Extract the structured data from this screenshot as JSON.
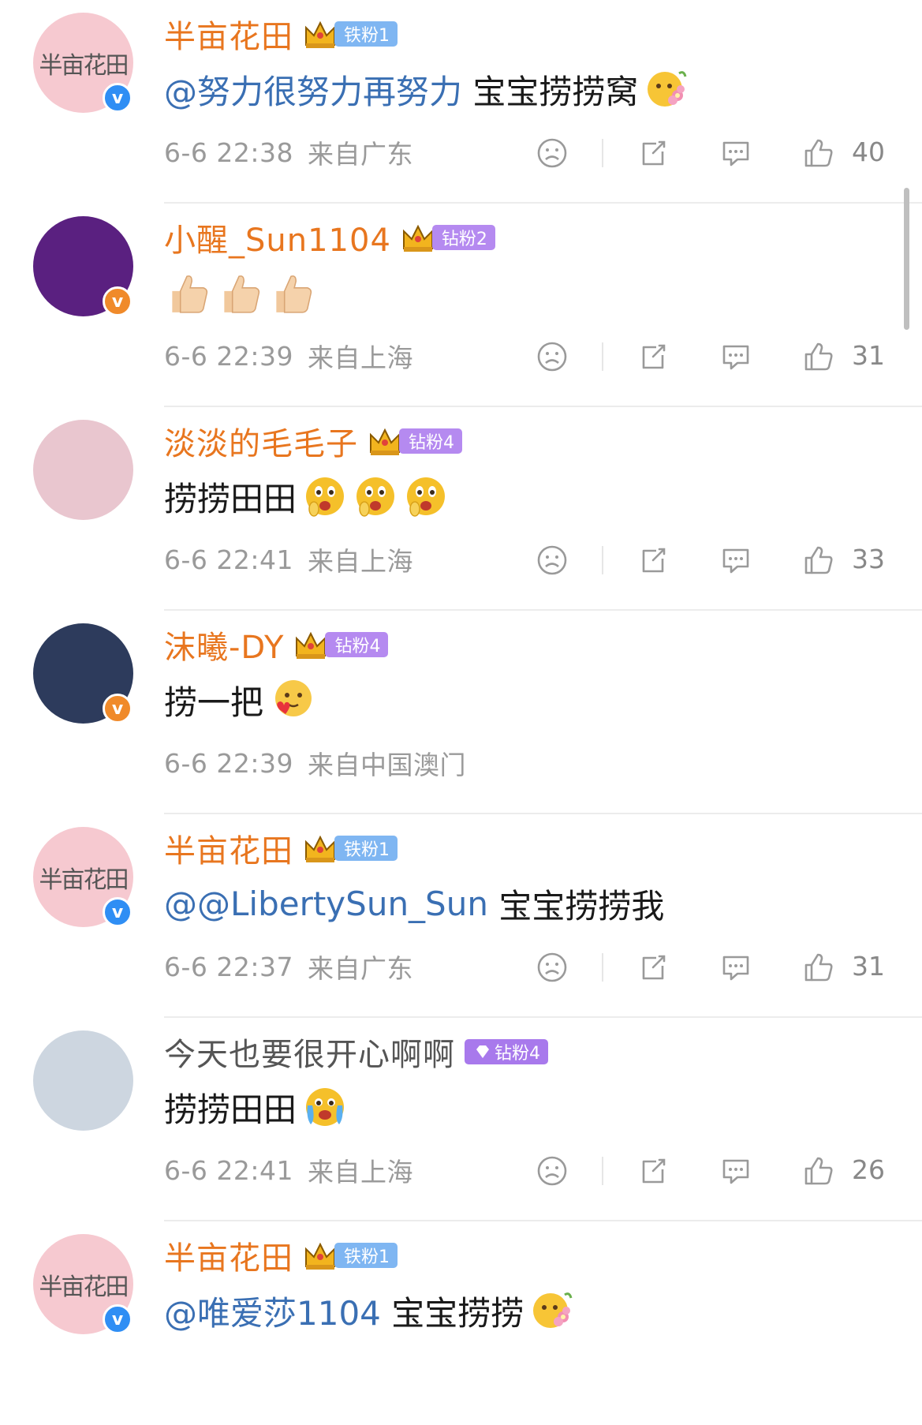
{
  "comments": [
    {
      "username": "半亩花田",
      "avatar_text": "半亩花田",
      "avatar_color": "#f6c9d0",
      "verify_color": "blue",
      "badge": {
        "type": "iron",
        "label": "铁粉1"
      },
      "mention": "@努力很努力再努力",
      "text": " 宝宝捞捞窝",
      "emojis": [
        "flower-emoji"
      ],
      "time": "6-6 22:38",
      "location": "来自广东",
      "likes": "40"
    },
    {
      "username": "小醒_Sun1104",
      "avatar_color": "#5a2080",
      "verify_color": "orange",
      "badge": {
        "type": "diamond",
        "label": "钻粉2"
      },
      "mention": "",
      "text": "",
      "emojis": [
        "thumbs-up-emoji",
        "thumbs-up-emoji",
        "thumbs-up-emoji"
      ],
      "time": "6-6 22:39",
      "location": "来自上海",
      "likes": "31"
    },
    {
      "username": "淡淡的毛毛子",
      "avatar_color": "#e9c6cf",
      "verify_color": "",
      "badge": {
        "type": "diamond",
        "label": "钻粉4"
      },
      "mention": "",
      "text": "捞捞田田",
      "emojis": [
        "shocked-emoji",
        "shocked-emoji",
        "shocked-emoji"
      ],
      "time": "6-6 22:41",
      "location": "来自上海",
      "likes": "33"
    },
    {
      "username": "沫曦-DY",
      "avatar_color": "#2d3b5c",
      "verify_color": "orange",
      "badge": {
        "type": "diamond",
        "label": "钻粉4"
      },
      "mention": "",
      "text": "捞一把",
      "emojis": [
        "heart-emoji"
      ],
      "time": "6-6 22:39",
      "location": "来自中国澳门",
      "likes": ""
    },
    {
      "username": "半亩花田",
      "avatar_text": "半亩花田",
      "avatar_color": "#f6c9d0",
      "verify_color": "blue",
      "badge": {
        "type": "iron",
        "label": "铁粉1"
      },
      "mention": "@@LibertySun_Sun",
      "text": " 宝宝捞捞我",
      "emojis": [],
      "time": "6-6 22:37",
      "location": "来自广东",
      "likes": "31"
    },
    {
      "username": "今天也要很开心啊啊",
      "avatar_color": "#cdd6e0",
      "verify_color": "",
      "badge": {
        "type": "purple",
        "label": "钻粉4"
      },
      "mention": "",
      "text": "捞捞田田",
      "emojis": [
        "cry-emoji"
      ],
      "time": "6-6 22:41",
      "location": "来自上海",
      "likes": "26"
    },
    {
      "username": "半亩花田",
      "avatar_text": "半亩花田",
      "avatar_color": "#f6c9d0",
      "verify_color": "blue",
      "badge": {
        "type": "iron",
        "label": "铁粉1"
      },
      "mention": "@唯爱莎1104",
      "text": " 宝宝捞捞",
      "emojis": [
        "flower-emoji"
      ],
      "time": "",
      "location": "",
      "likes": ""
    }
  ]
}
